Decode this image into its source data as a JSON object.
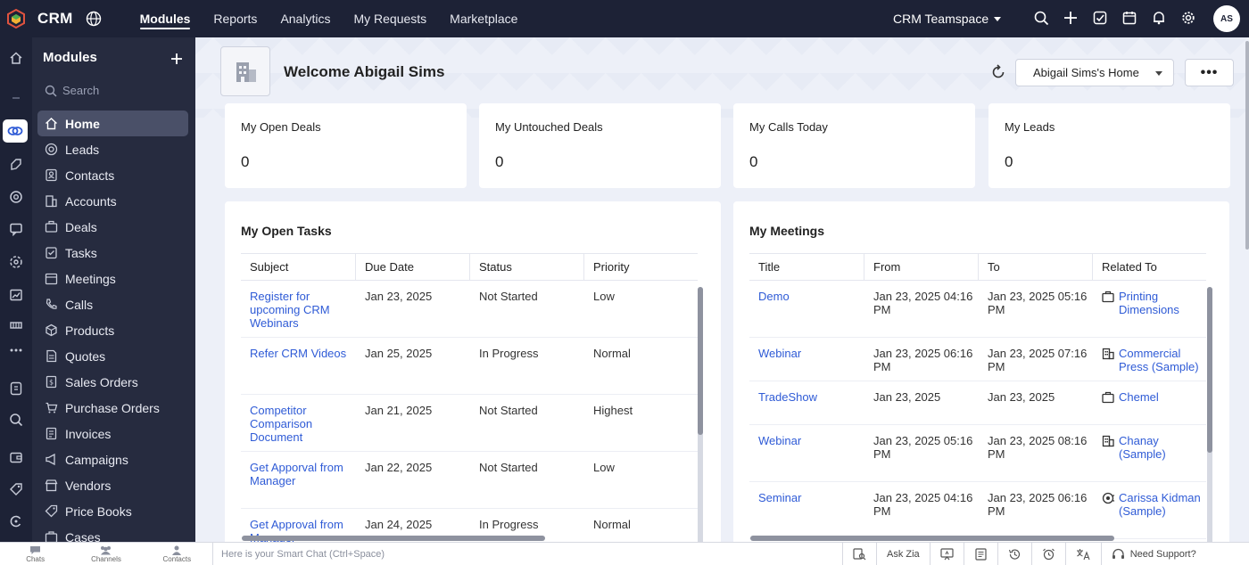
{
  "topbar": {
    "brand": "CRM",
    "nav": [
      {
        "label": "Modules",
        "active": true
      },
      {
        "label": "Reports"
      },
      {
        "label": "Analytics"
      },
      {
        "label": "My Requests"
      },
      {
        "label": "Marketplace"
      }
    ],
    "teamspace": "CRM Teamspace",
    "avatar_initials": "AS",
    "icons": [
      "search-icon",
      "plus-icon",
      "check-square-icon",
      "calendar-icon",
      "bell-icon",
      "gear-icon"
    ]
  },
  "sidebar": {
    "title": "Modules",
    "search_placeholder": "Search",
    "items": [
      {
        "label": "Home",
        "icon": "home-icon",
        "active": true
      },
      {
        "label": "Leads",
        "icon": "leads-icon"
      },
      {
        "label": "Contacts",
        "icon": "contacts-icon"
      },
      {
        "label": "Accounts",
        "icon": "accounts-icon"
      },
      {
        "label": "Deals",
        "icon": "deals-icon"
      },
      {
        "label": "Tasks",
        "icon": "tasks-icon"
      },
      {
        "label": "Meetings",
        "icon": "meetings-icon"
      },
      {
        "label": "Calls",
        "icon": "calls-icon"
      },
      {
        "label": "Products",
        "icon": "products-icon"
      },
      {
        "label": "Quotes",
        "icon": "quotes-icon"
      },
      {
        "label": "Sales Orders",
        "icon": "sales-orders-icon"
      },
      {
        "label": "Purchase Orders",
        "icon": "purchase-orders-icon"
      },
      {
        "label": "Invoices",
        "icon": "invoices-icon"
      },
      {
        "label": "Campaigns",
        "icon": "campaigns-icon"
      },
      {
        "label": "Vendors",
        "icon": "vendors-icon"
      },
      {
        "label": "Price Books",
        "icon": "price-books-icon"
      },
      {
        "label": "Cases",
        "icon": "cases-icon"
      }
    ]
  },
  "header": {
    "welcome": "Welcome Abigail Sims",
    "home_select": "Abigail Sims's Home",
    "more": "•••"
  },
  "stats": [
    {
      "label": "My Open Deals",
      "value": "0"
    },
    {
      "label": "My Untouched Deals",
      "value": "0"
    },
    {
      "label": "My Calls Today",
      "value": "0"
    },
    {
      "label": "My Leads",
      "value": "0"
    }
  ],
  "tasks": {
    "title": "My Open Tasks",
    "columns": [
      "Subject",
      "Due Date",
      "Status",
      "Priority"
    ],
    "rows": [
      {
        "subject": "Register for upcoming CRM Webinars",
        "due": "Jan 23, 2025",
        "status": "Not Started",
        "priority": "Low"
      },
      {
        "subject": "Refer CRM Videos",
        "due": "Jan 25, 2025",
        "status": "In Progress",
        "priority": "Normal"
      },
      {
        "subject": "Competitor Comparison Document",
        "due": "Jan 21, 2025",
        "status": "Not Started",
        "priority": "Highest"
      },
      {
        "subject": "Get Apporval from Manager",
        "due": "Jan 22, 2025",
        "status": "Not Started",
        "priority": "Low"
      },
      {
        "subject": "Get Approval from Manager",
        "due": "Jan 24, 2025",
        "status": "In Progress",
        "priority": "Normal"
      }
    ]
  },
  "meetings": {
    "title": "My Meetings",
    "columns": [
      "Title",
      "From",
      "To",
      "Related To"
    ],
    "rows": [
      {
        "title": "Demo",
        "from": "Jan 23, 2025 04:16 PM",
        "to": "Jan 23, 2025 05:16 PM",
        "related": "Printing Dimensions",
        "related_icon": "briefcase-icon"
      },
      {
        "title": "Webinar",
        "from": "Jan 23, 2025 06:16 PM",
        "to": "Jan 23, 2025 07:16 PM",
        "related": "Commercial Press (Sample)",
        "related_icon": "building-icon"
      },
      {
        "title": "TradeShow",
        "from": "Jan 23, 2025",
        "to": "Jan 23, 2025",
        "related": "Chemel",
        "related_icon": "briefcase-icon"
      },
      {
        "title": "Webinar",
        "from": "Jan 23, 2025 05:16 PM",
        "to": "Jan 23, 2025 08:16 PM",
        "related": "Chanay (Sample)",
        "related_icon": "building-icon"
      },
      {
        "title": "Seminar",
        "from": "Jan 23, 2025 04:16 PM",
        "to": "Jan 23, 2025 06:16 PM",
        "related": "Carissa Kidman (Sample)",
        "related_icon": "contact-icon"
      }
    ]
  },
  "bottombar": {
    "tabs": [
      "Chats",
      "Channels",
      "Contacts"
    ],
    "smartchat_placeholder": "Here is your Smart Chat (Ctrl+Space)",
    "ask_zia": "Ask Zia",
    "need_support": "Need Support?"
  }
}
